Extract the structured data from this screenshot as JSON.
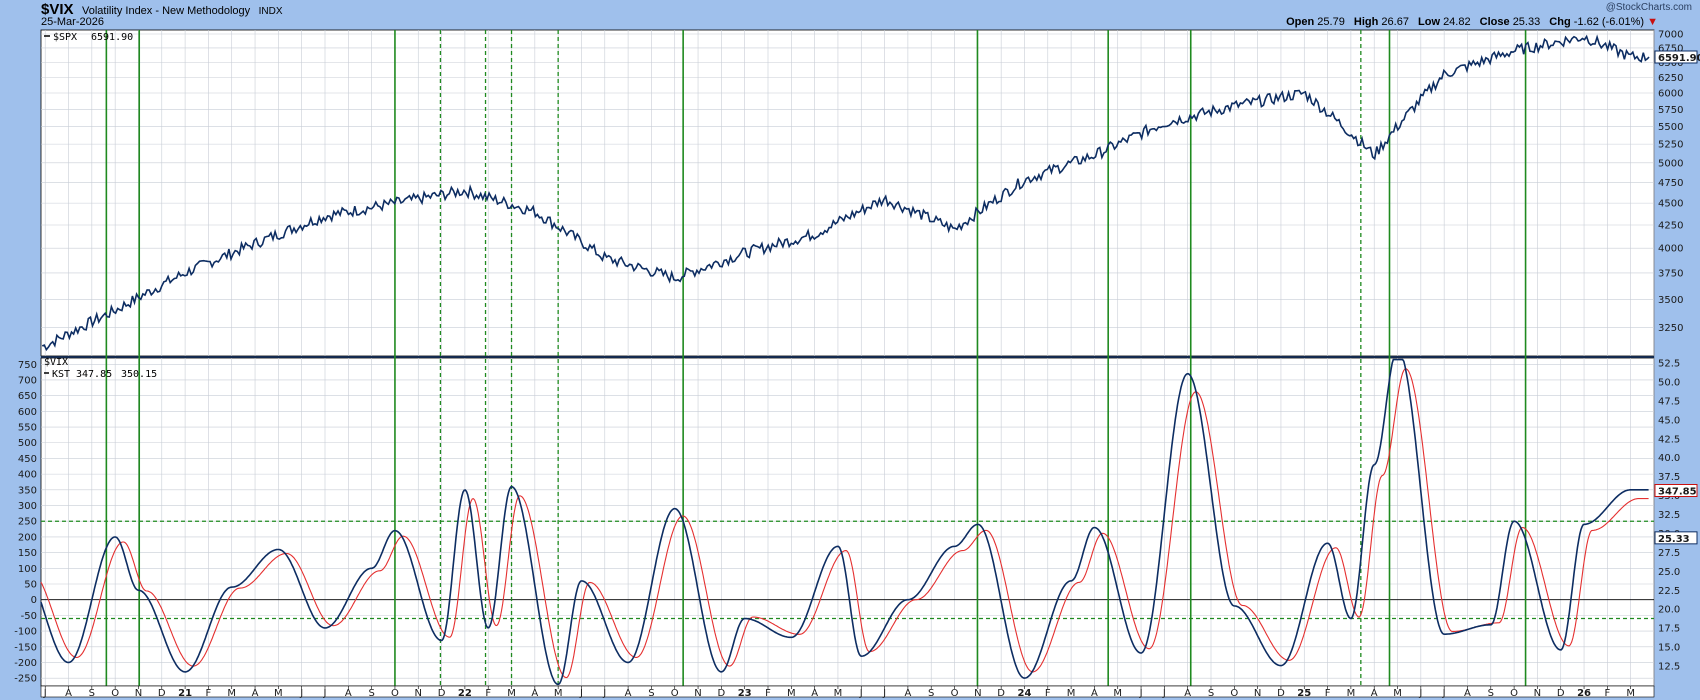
{
  "header": {
    "symbol": "$VIX",
    "description": "Volatility Index - New Methodology",
    "exchange": "INDX",
    "date": "25-Mar-2026",
    "watermark": "@StockCharts.com",
    "open_label": "Open",
    "open": "25.79",
    "high_label": "High",
    "high": "26.67",
    "low_label": "Low",
    "low": "24.82",
    "close_label": "Close",
    "close": "25.33",
    "chg_label": "Chg",
    "chg": "-1.62 (-6.01%)",
    "chg_icon": "down-triangle-icon",
    "negative_color": "#c81010"
  },
  "colors": {
    "background": "#9fc0ec",
    "plot": "#ffffff",
    "line": "#0d2d62",
    "signal": "#e53030",
    "grid": "#c8cdd6",
    "vline": "#1f8a1f",
    "hline": "#1f8a1f"
  },
  "chart_data": [
    {
      "type": "line",
      "series": [
        {
          "name": "$SPX",
          "value_label": "6591.90"
        }
      ],
      "last_value_label": "6591.90",
      "yticks": [
        3250,
        3500,
        3750,
        4000,
        4250,
        4500,
        4750,
        5000,
        5250,
        5500,
        5750,
        6000,
        6250,
        6500,
        6750,
        7000
      ],
      "ylim": [
        3050,
        7000
      ],
      "y_scale": "log",
      "x": [
        "2020-07",
        "2020-10",
        "2021-01",
        "2021-04",
        "2021-07",
        "2021-10",
        "2022-01",
        "2022-04",
        "2022-07",
        "2022-10",
        "2023-01",
        "2023-04",
        "2023-07",
        "2023-10",
        "2024-01",
        "2024-04",
        "2024-07",
        "2024-10",
        "2025-01",
        "2025-04",
        "2025-07",
        "2025-10",
        "2026-01",
        "2026-03"
      ],
      "y": [
        3100,
        3400,
        3750,
        4050,
        4350,
        4500,
        4650,
        4400,
        3900,
        3700,
        3950,
        4150,
        4550,
        4200,
        4780,
        5100,
        5550,
        5800,
        6000,
        5100,
        6300,
        6700,
        6950,
        6591.9
      ]
    },
    {
      "type": "line",
      "label": "$VIX",
      "series": [
        {
          "name": "KST",
          "value_label": "347.85"
        },
        {
          "name": "",
          "value_label": "350.15"
        }
      ],
      "left_yticks": [
        -250,
        -200,
        -150,
        -100,
        -50,
        0,
        50,
        100,
        150,
        200,
        250,
        300,
        350,
        400,
        450,
        500,
        550,
        600,
        650,
        700,
        750
      ],
      "left_ylim": [
        -275,
        770
      ],
      "right_yticks": [
        "12.5",
        "15.0",
        "17.5",
        "20.0",
        "22.5",
        "25.0",
        "27.5",
        "30.0",
        "32.5",
        "35.0",
        "37.5",
        "40.0",
        "42.5",
        "45.0",
        "47.5",
        "50.0",
        "52.5"
      ],
      "right_value_label": "347.85",
      "right_close_label": "25.33",
      "horizontal_lines": [
        250,
        0,
        -60
      ],
      "kst_x": [
        "2020-06",
        "2020-08",
        "2020-10",
        "2020-11",
        "2021-01",
        "2021-03",
        "2021-05",
        "2021-07",
        "2021-09",
        "2021-10",
        "2021-12",
        "2022-01",
        "2022-02",
        "2022-03",
        "2022-05",
        "2022-06",
        "2022-08",
        "2022-10",
        "2022-12",
        "2023-01",
        "2023-03",
        "2023-05",
        "2023-06",
        "2023-08",
        "2023-10",
        "2023-11",
        "2024-01",
        "2024-03",
        "2024-04",
        "2024-06",
        "2024-08",
        "2024-10",
        "2024-12",
        "2025-02",
        "2025-03",
        "2025-04",
        "2025-05",
        "2025-07",
        "2025-09",
        "2025-10",
        "2025-12",
        "2026-01",
        "2026-03"
      ],
      "kst": [
        100,
        -200,
        200,
        30,
        -230,
        40,
        160,
        -90,
        100,
        220,
        -130,
        350,
        -90,
        360,
        -270,
        60,
        -200,
        290,
        -230,
        -60,
        -120,
        170,
        -180,
        0,
        170,
        240,
        -250,
        60,
        230,
        -170,
        720,
        -20,
        -210,
        180,
        -60,
        430,
        800,
        -110,
        -80,
        250,
        -160,
        240,
        350
      ]
    }
  ],
  "x_axis": {
    "labels": [
      "J",
      "A",
      "S",
      "O",
      "N",
      "D",
      "21",
      "F",
      "M",
      "A",
      "M",
      "J",
      "J",
      "A",
      "S",
      "O",
      "N",
      "D",
      "22",
      "F",
      "M",
      "A",
      "M",
      "J",
      "J",
      "A",
      "S",
      "O",
      "N",
      "D",
      "23",
      "F",
      "M",
      "A",
      "M",
      "J",
      "J",
      "A",
      "S",
      "O",
      "N",
      "D",
      "24",
      "F",
      "M",
      "A",
      "M",
      "J",
      "J",
      "A",
      "S",
      "O",
      "N",
      "D",
      "25",
      "F",
      "M",
      "A",
      "M",
      "J",
      "J",
      "A",
      "S",
      "O",
      "N",
      "D",
      "26",
      "F",
      "M",
      "A"
    ],
    "year_labels": [
      "21",
      "22",
      "23",
      "24",
      "25",
      "26"
    ]
  },
  "vertical_markers": [
    {
      "date": "2020-09-20",
      "style": "solid"
    },
    {
      "date": "2020-11-02",
      "style": "solid"
    },
    {
      "date": "2021-10-01",
      "style": "solid"
    },
    {
      "date": "2021-11-30",
      "style": "dashed"
    },
    {
      "date": "2022-01-28",
      "style": "dashed"
    },
    {
      "date": "2022-03-01",
      "style": "dashed"
    },
    {
      "date": "2022-05-01",
      "style": "dashed"
    },
    {
      "date": "2022-10-12",
      "style": "solid"
    },
    {
      "date": "2023-10-31",
      "style": "solid"
    },
    {
      "date": "2024-04-19",
      "style": "solid"
    },
    {
      "date": "2024-08-05",
      "style": "solid"
    },
    {
      "date": "2025-03-14",
      "style": "dashed"
    },
    {
      "date": "2025-04-21",
      "style": "solid"
    },
    {
      "date": "2025-10-16",
      "style": "solid"
    }
  ]
}
